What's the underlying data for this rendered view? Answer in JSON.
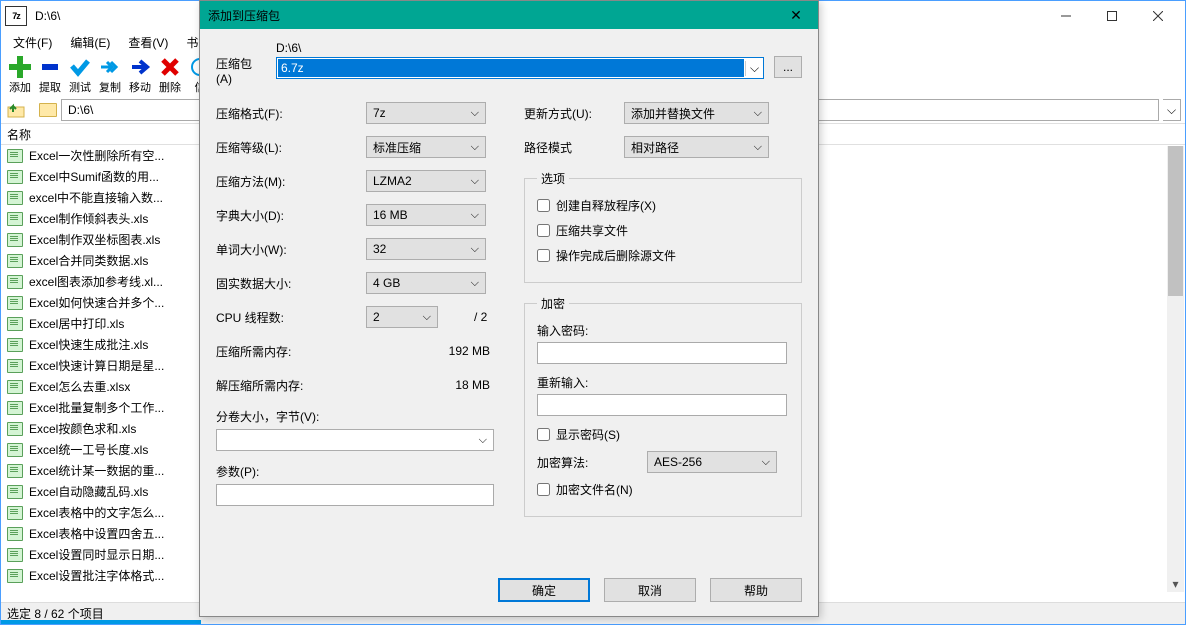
{
  "main": {
    "title": "D:\\6\\",
    "menu": [
      "文件(F)",
      "编辑(E)",
      "查看(V)",
      "书签("
    ],
    "toolbar": [
      {
        "icon": "plus",
        "color": "#2aa82a",
        "label": "添加"
      },
      {
        "icon": "minus",
        "color": "#0033cc",
        "label": "提取"
      },
      {
        "icon": "check",
        "color": "#0099e5",
        "label": "测试"
      },
      {
        "icon": "copy",
        "color": "#0099e5",
        "label": "复制"
      },
      {
        "icon": "move",
        "color": "#0033cc",
        "label": "移动"
      },
      {
        "icon": "delete",
        "color": "#e00000",
        "label": "删除"
      },
      {
        "icon": "info",
        "color": "#0099e5",
        "label": "信"
      }
    ],
    "path": "D:\\6\\",
    "col_header": "名称",
    "files": [
      "Excel一次性删除所有空...",
      "Excel中Sumif函数的用...",
      "excel中不能直接输入数...",
      "Excel制作倾斜表头.xls",
      "Excel制作双坐标图表.xls",
      "Excel合并同类数据.xls",
      "excel图表添加参考线.xl...",
      "Excel如何快速合并多个...",
      "Excel居中打印.xls",
      "Excel快速生成批注.xls",
      "Excel快速计算日期是星...",
      "Excel怎么去重.xlsx",
      "Excel批量复制多个工作...",
      "Excel按颜色求和.xls",
      "Excel统一工号长度.xls",
      "Excel统计某一数据的重...",
      "Excel自动隐藏乱码.xls",
      "Excel表格中的文字怎么...",
      "Excel表格中设置四舍五...",
      "Excel设置同时显示日期...",
      "Excel设置批注字体格式..."
    ],
    "status": "选定 8 / 62 个项目"
  },
  "dialog": {
    "title": "添加到压缩包",
    "archive_label": "压缩包(A)",
    "archive_path_prefix": "D:\\6\\",
    "archive_name": "6.7z",
    "left": {
      "format_lbl": "压缩格式(F):",
      "format_val": "7z",
      "level_lbl": "压缩等级(L):",
      "level_val": "标准压缩",
      "method_lbl": "压缩方法(M):",
      "method_val": "LZMA2",
      "dict_lbl": "字典大小(D):",
      "dict_val": "16 MB",
      "word_lbl": "单词大小(W):",
      "word_val": "32",
      "solid_lbl": "固实数据大小:",
      "solid_val": "4 GB",
      "cpu_lbl": "CPU 线程数:",
      "cpu_val": "2",
      "cpu_max": "/ 2",
      "mem_comp_lbl": "压缩所需内存:",
      "mem_comp_val": "192 MB",
      "mem_decomp_lbl": "解压缩所需内存:",
      "mem_decomp_val": "18 MB",
      "split_lbl": "分卷大小，字节(V):",
      "params_lbl": "参数(P):"
    },
    "right": {
      "update_lbl": "更新方式(U):",
      "update_val": "添加并替换文件",
      "pathmode_lbl": "路径模式",
      "pathmode_val": "相对路径",
      "options_legend": "选项",
      "opt_sfx": "创建自释放程序(X)",
      "opt_shared": "压缩共享文件",
      "opt_delete": "操作完成后删除源文件",
      "enc_legend": "加密",
      "pwd_lbl": "输入密码:",
      "pwd2_lbl": "重新输入:",
      "show_pwd": "显示密码(S)",
      "enc_method_lbl": "加密算法:",
      "enc_method_val": "AES-256",
      "enc_names": "加密文件名(N)"
    },
    "buttons": {
      "ok": "确定",
      "cancel": "取消",
      "help": "帮助"
    }
  }
}
